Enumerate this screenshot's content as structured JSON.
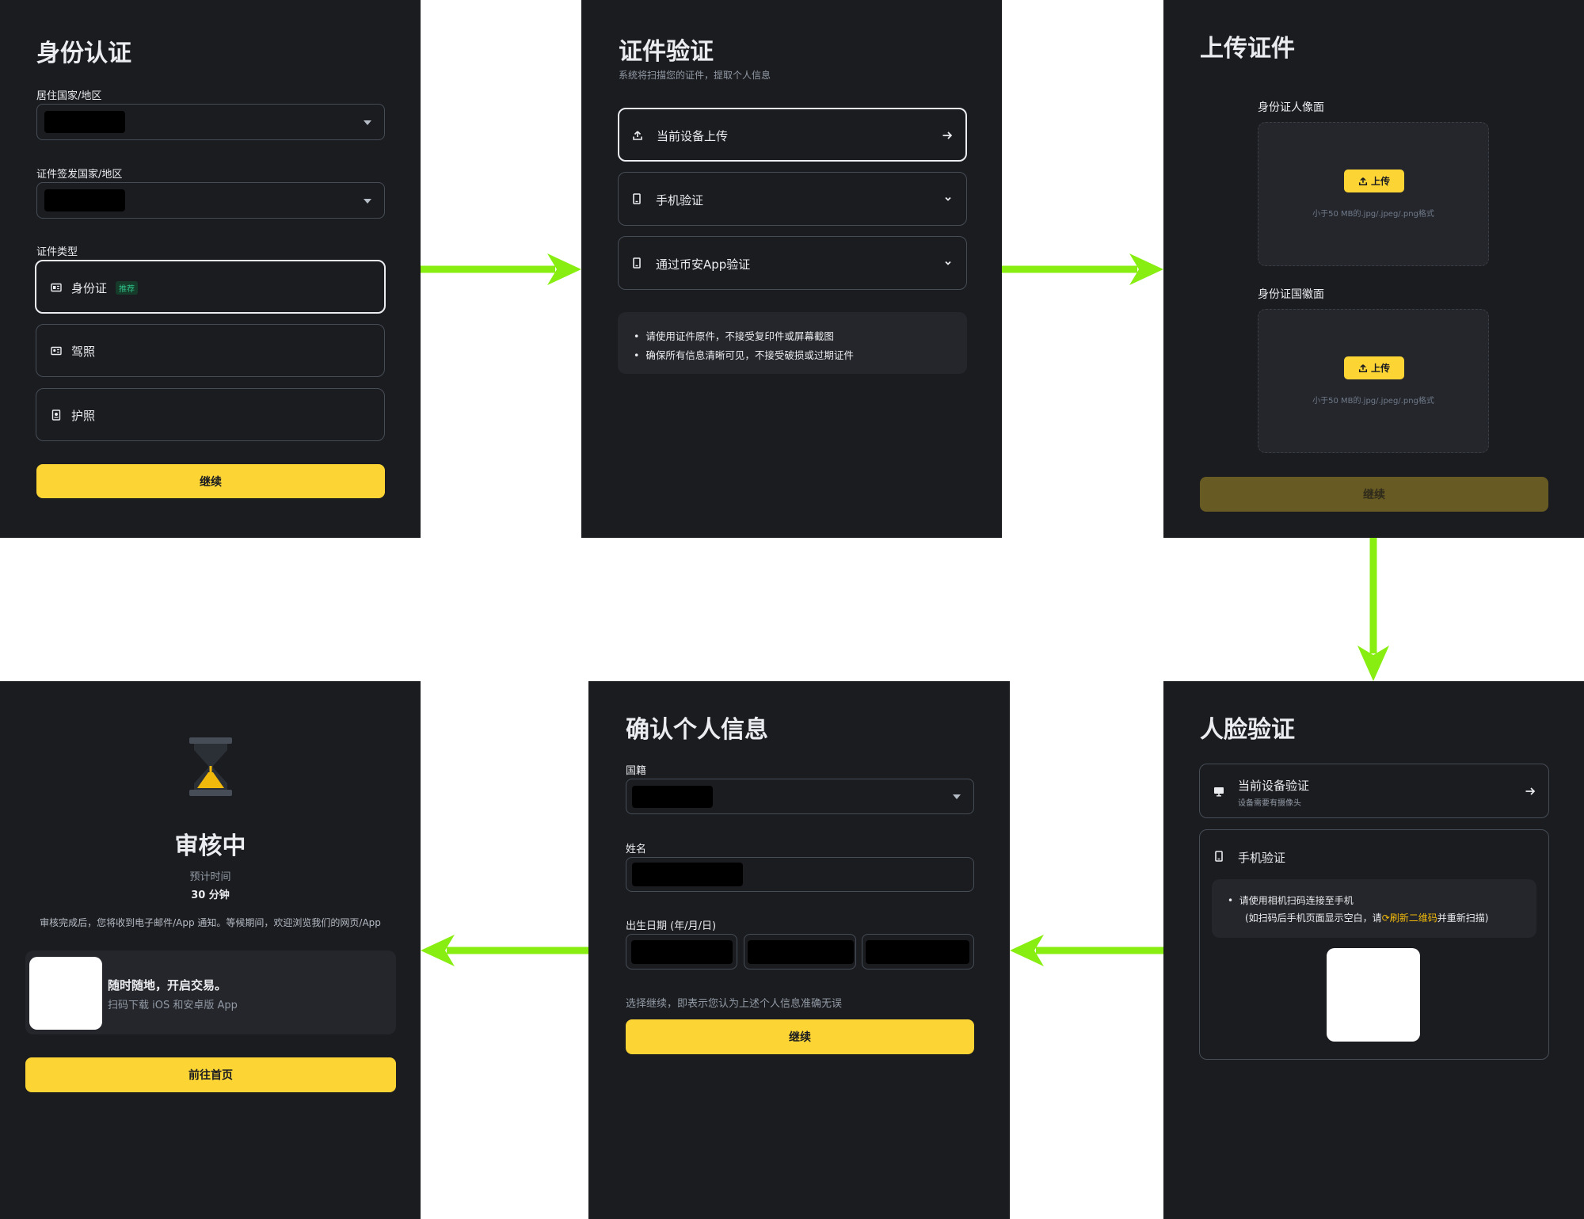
{
  "colors": {
    "accent": "#fcd535",
    "panel_bg": "#1b1c20",
    "flow_arrow": "#88ee11",
    "badge_green": "#2ebd85"
  },
  "panel1": {
    "title": "身份认证",
    "residence_label": "居住国家/地区",
    "issuing_label": "证件签发国家/地区",
    "doc_type_label": "证件类型",
    "options": [
      {
        "label": "身份证",
        "icon": "id-card-icon",
        "badge": "推荐",
        "selected": true
      },
      {
        "label": "驾照",
        "icon": "license-icon",
        "selected": false
      },
      {
        "label": "护照",
        "icon": "passport-icon",
        "selected": false
      }
    ],
    "continue": "继续"
  },
  "panel2": {
    "title": "证件验证",
    "subtitle": "系统将扫描您的证件，提取个人信息",
    "options": [
      {
        "label": "当前设备上传",
        "icon": "upload-icon",
        "trailing": "arrow-right-icon"
      },
      {
        "label": "手机验证",
        "icon": "phone-icon",
        "trailing": "chevron-down-icon"
      },
      {
        "label": "通过币安App验证",
        "icon": "phone-icon",
        "trailing": "chevron-down-icon"
      }
    ],
    "tips": [
      "请使用证件原件，不接受复印件或屏幕截图",
      "确保所有信息清晰可见，不接受破损或过期证件"
    ]
  },
  "panel3": {
    "title": "上传证件",
    "front_label": "身份证人像面",
    "back_label": "身份证国徽面",
    "upload_label": "上传",
    "hint": "小于50 MB的.jpg/.jpeg/.png格式",
    "continue": "继续"
  },
  "panel4": {
    "title": "人脸验证",
    "device_option": "当前设备验证",
    "device_sub": "设备需要有摄像头",
    "phone_option": "手机验证",
    "scan_line1": "请使用相机扫码连接至手机",
    "scan_line2_pre": "(如扫码后手机页面显示空白，请",
    "scan_refresh": "刷新二维码",
    "scan_line2_post": "并重新扫描)"
  },
  "panel5": {
    "title": "确认个人信息",
    "nationality_label": "国籍",
    "name_label": "姓名",
    "dob_label": "出生日期 (年/月/日)",
    "disclaimer": "选择继续，即表示您认为上述个人信息准确无误",
    "continue": "继续"
  },
  "panel6": {
    "status": "审核中",
    "eta_label": "预计时间",
    "eta_value": "30 分钟",
    "notice": "审核完成后，您将收到电子邮件/App 通知。等候期间，欢迎浏览我们的网页/App",
    "promo_title": "随时随地，开启交易。",
    "promo_sub": "扫码下载 iOS 和安卓版 App",
    "home_button": "前往首页"
  }
}
